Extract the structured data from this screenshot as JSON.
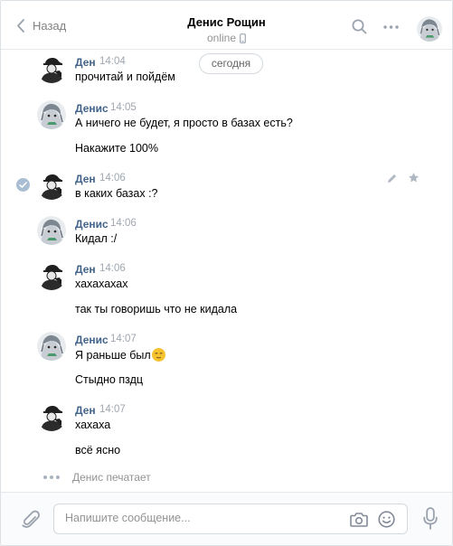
{
  "header": {
    "back_label": "Назад",
    "title": "Денис Рощин",
    "status": "online"
  },
  "date_separator": "сегодня",
  "messages": [
    {
      "name": "Ден",
      "time": "14:04",
      "lines": [
        "прочитай и пойдём"
      ],
      "avatar": "sherlock-avatar"
    },
    {
      "name": "Денис",
      "time": "14:05",
      "lines": [
        "А ничего не будет, я просто в базах есть?",
        "Накажите 100%"
      ],
      "avatar": "anime-avatar"
    },
    {
      "name": "Ден",
      "time": "14:06",
      "lines": [
        "в каких базах :?"
      ],
      "avatar": "sherlock-avatar",
      "selected": true
    },
    {
      "name": "Денис",
      "time": "14:06",
      "lines": [
        "Кидал :/"
      ],
      "avatar": "anime-avatar"
    },
    {
      "name": "Ден",
      "time": "14:06",
      "lines": [
        "хахахахах",
        "так ты говоришь что не кидала"
      ],
      "avatar": "sherlock-avatar"
    },
    {
      "name": "Денис",
      "time": "14:07",
      "lines": [
        "Я раньше был",
        "Стыдно пздц"
      ],
      "avatar": "anime-avatar"
    },
    {
      "name": "Ден",
      "time": "14:07",
      "lines": [
        "хахаха",
        "всё ясно"
      ],
      "avatar": "sherlock-avatar"
    }
  ],
  "typing_indicator": "Денис печатает",
  "composer": {
    "placeholder": "Напишите сообщение..."
  },
  "colors": {
    "name_link": "#42648b",
    "timestamp": "#a0a7b0",
    "muted": "#939393"
  }
}
